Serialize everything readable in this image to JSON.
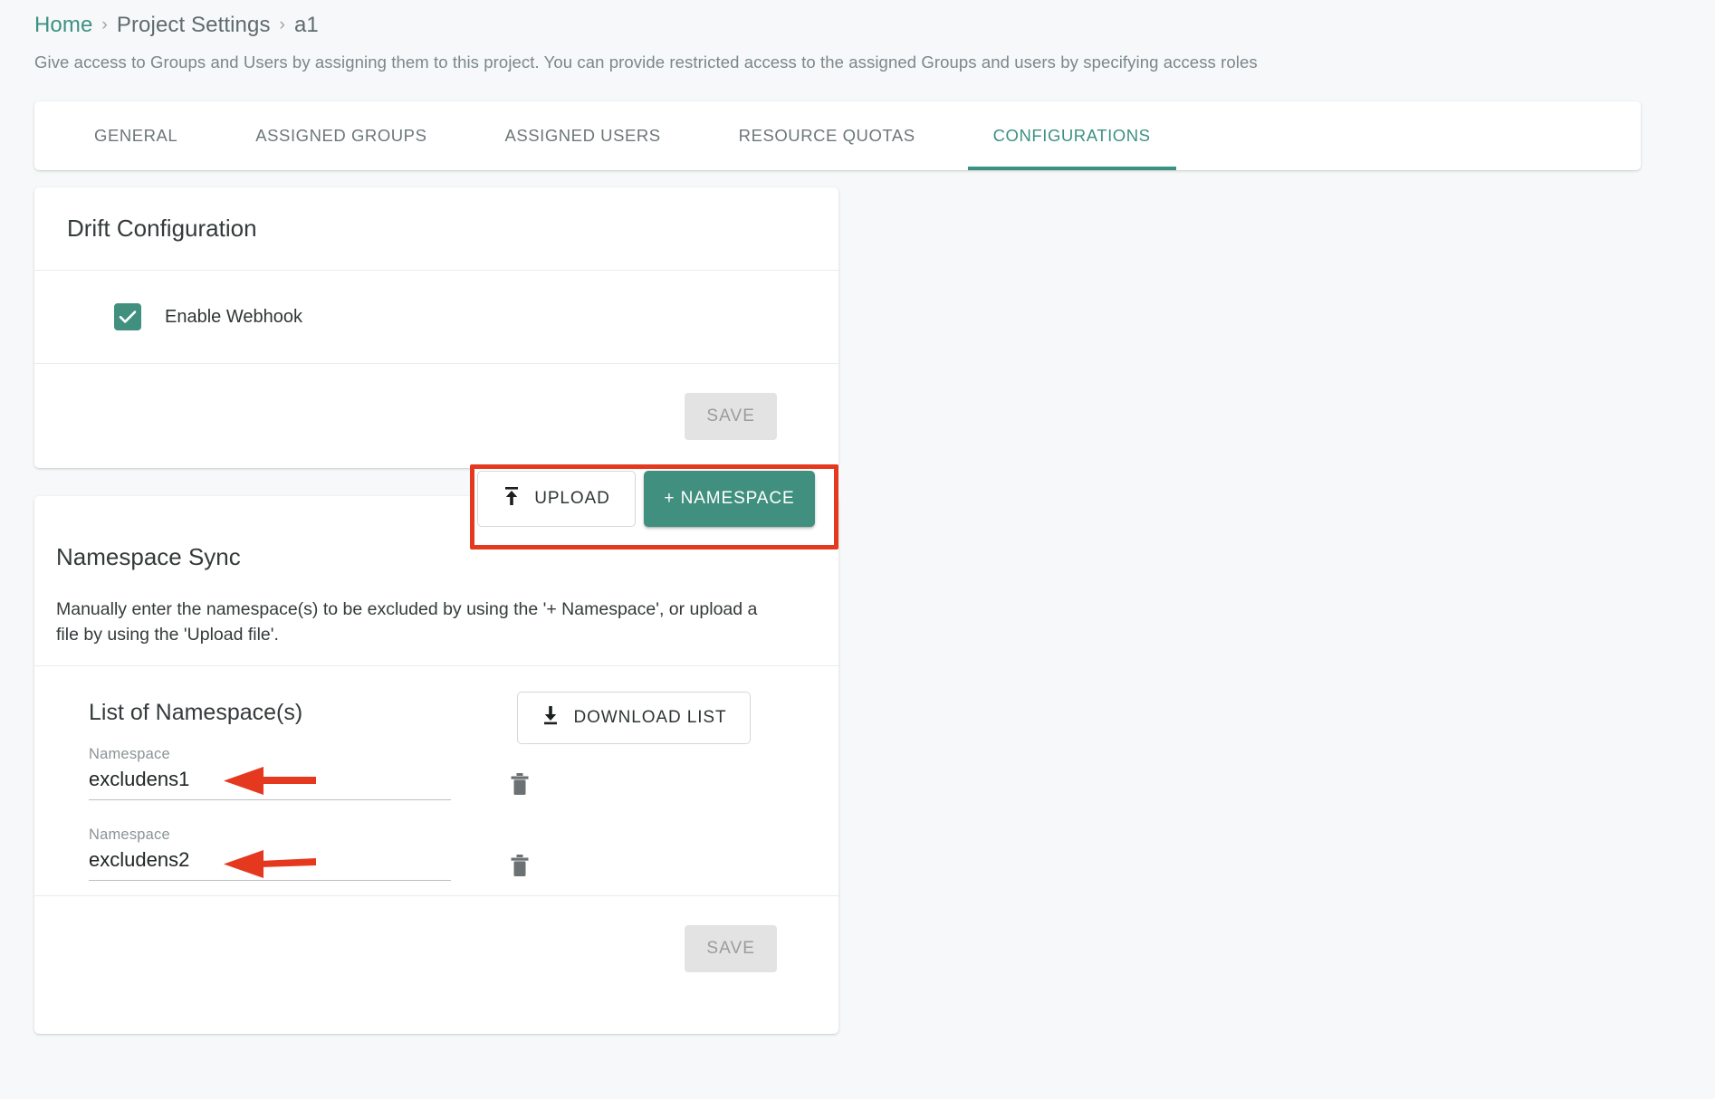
{
  "breadcrumb": {
    "home": "Home",
    "separator": "›",
    "section": "Project Settings",
    "current": "a1"
  },
  "subtitle": "Give access to Groups and Users by assigning them to this project. You can provide restricted access to the assigned Groups and users by specifying access roles",
  "tabs": [
    {
      "label": "GENERAL",
      "active": false
    },
    {
      "label": "ASSIGNED GROUPS",
      "active": false
    },
    {
      "label": "ASSIGNED USERS",
      "active": false
    },
    {
      "label": "RESOURCE QUOTAS",
      "active": false
    },
    {
      "label": "CONFIGURATIONS",
      "active": true
    }
  ],
  "drift": {
    "title": "Drift Configuration",
    "checkbox_label": "Enable Webhook",
    "checkbox_checked": true,
    "save_label": "SAVE"
  },
  "namespace_sync": {
    "title": "Namespace Sync",
    "description": "Manually enter the namespace(s) to be excluded by using the '+ Namespace', or upload a file by using the 'Upload file'.",
    "upload_label": "UPLOAD",
    "upload_icon": "upload-icon",
    "add_namespace_label": "+ NAMESPACE",
    "list_title": "List of Namespace(s)",
    "download_label": "DOWNLOAD LIST",
    "download_icon": "download-icon",
    "field_label": "Namespace",
    "field_placeholder": "Namespace",
    "delete_icon": "trash-icon",
    "namespaces": [
      {
        "label": "Namespace",
        "value": "excludens1"
      },
      {
        "label": "Namespace",
        "value": "excludens2"
      }
    ],
    "save_label": "SAVE"
  },
  "colors": {
    "accent_teal": "#41907f",
    "link_teal": "#3d9183",
    "highlight_red": "#e5391f",
    "page_background": "#f6f8f9",
    "card_background": "#ffffff",
    "disabled_button": "#e3e3e3"
  }
}
